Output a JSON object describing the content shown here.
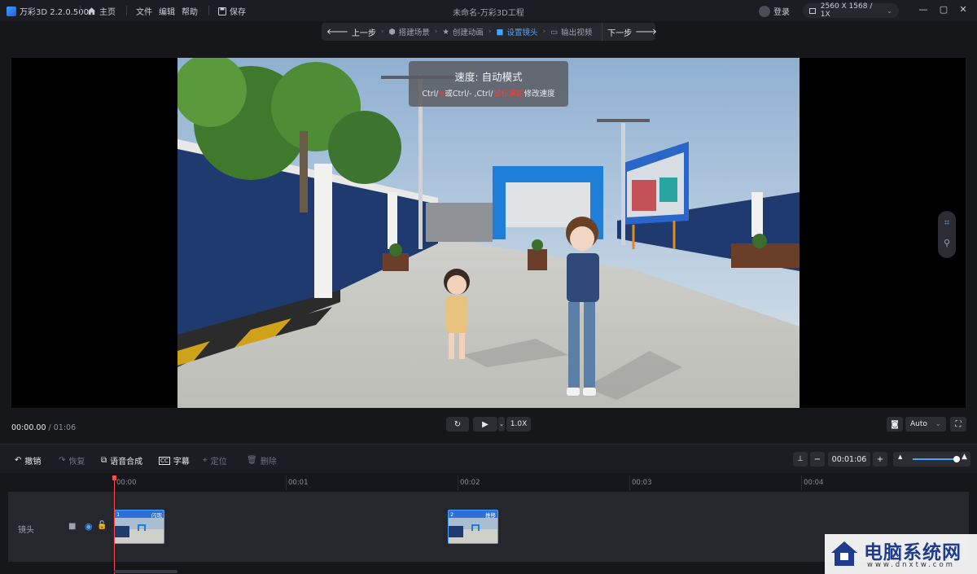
{
  "app": {
    "name": "万彩3D 2.2.0.500",
    "window_title": "未命名-万彩3D工程",
    "menu": [
      "主页",
      "文件",
      "编辑",
      "帮助",
      "保存"
    ],
    "login": "登录",
    "resolution": "2560 X 1568 / 1X"
  },
  "steps": {
    "prev": "上一步",
    "items": [
      "搭建场景",
      "创建动画",
      "设置镜头",
      "输出视频"
    ],
    "active_index": 2,
    "next": "下一步"
  },
  "speed_tip": {
    "title": "速度: 自动模式",
    "desc_part1": "Ctrl/",
    "desc_red1": "+",
    "desc_part2": "或Ctrl/- ,Ctrl/",
    "desc_red2": "鼠标滚轮",
    "desc_part3": "修改速度"
  },
  "playback": {
    "current_time": "00:00.00",
    "separator": " / ",
    "total_time": "01:06",
    "speed": "1.0X",
    "quality": "Auto"
  },
  "toolbar": {
    "undo": "撤销",
    "redo": "恢复",
    "tts": "语音合成",
    "subtitle": "字幕",
    "locate": "定位",
    "delete": "删除",
    "duration": "00:01:06"
  },
  "timeline": {
    "ticks": [
      "00:00",
      "00:01",
      "00:02",
      "00:03",
      "00:04"
    ],
    "track_name": "镜头",
    "clips": [
      {
        "index": "1",
        "label": "闪现"
      },
      {
        "index": "2",
        "label": "推移"
      }
    ]
  },
  "watermark": {
    "title": "电脑系统网",
    "url": "www.dnxtw.com"
  },
  "colors": {
    "accent": "#4aa3ff",
    "background": "#16171b",
    "panel": "#1c1d22",
    "playhead": "#ff4d4f"
  }
}
